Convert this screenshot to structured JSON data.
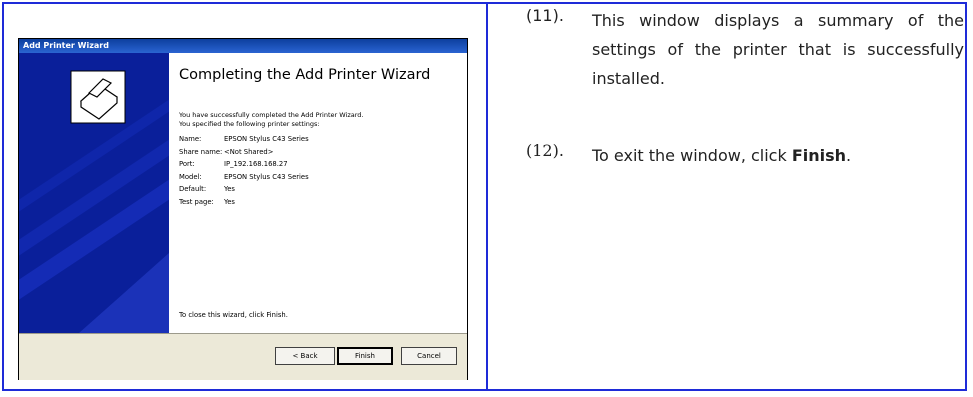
{
  "wizard": {
    "title": "Add Printer Wizard",
    "heading": "Completing the Add Printer Wizard",
    "intro_line1": "You have successfully completed the Add Printer Wizard.",
    "intro_line2": "You specified the following printer settings:",
    "settings": [
      {
        "label": "Name:",
        "value": "EPSON Stylus C43 Series"
      },
      {
        "label": "Share name:",
        "value": "<Not Shared>"
      },
      {
        "label": "Port:",
        "value": "IP_192.168.168.27"
      },
      {
        "label": "Model:",
        "value": "EPSON Stylus C43 Series"
      },
      {
        "label": "Default:",
        "value": "Yes"
      },
      {
        "label": "Test page:",
        "value": "Yes"
      }
    ],
    "close_note": "To close this wizard, click Finish.",
    "buttons": {
      "back": "< Back",
      "finish": "Finish",
      "cancel": "Cancel"
    }
  },
  "steps": [
    {
      "number": "(11).",
      "text": "This window displays a summary of the settings of the printer that is successfully installed."
    },
    {
      "number": "(12).",
      "text_before": "To exit the window, click ",
      "text_bold": "Finish",
      "text_after": "."
    }
  ],
  "colors": {
    "border": "#1e2bd8",
    "wizard_panel": "#0a1f9a",
    "titlebar": "#0d3f9e"
  },
  "icons": {
    "wizard_graphic": "printer-icon"
  }
}
